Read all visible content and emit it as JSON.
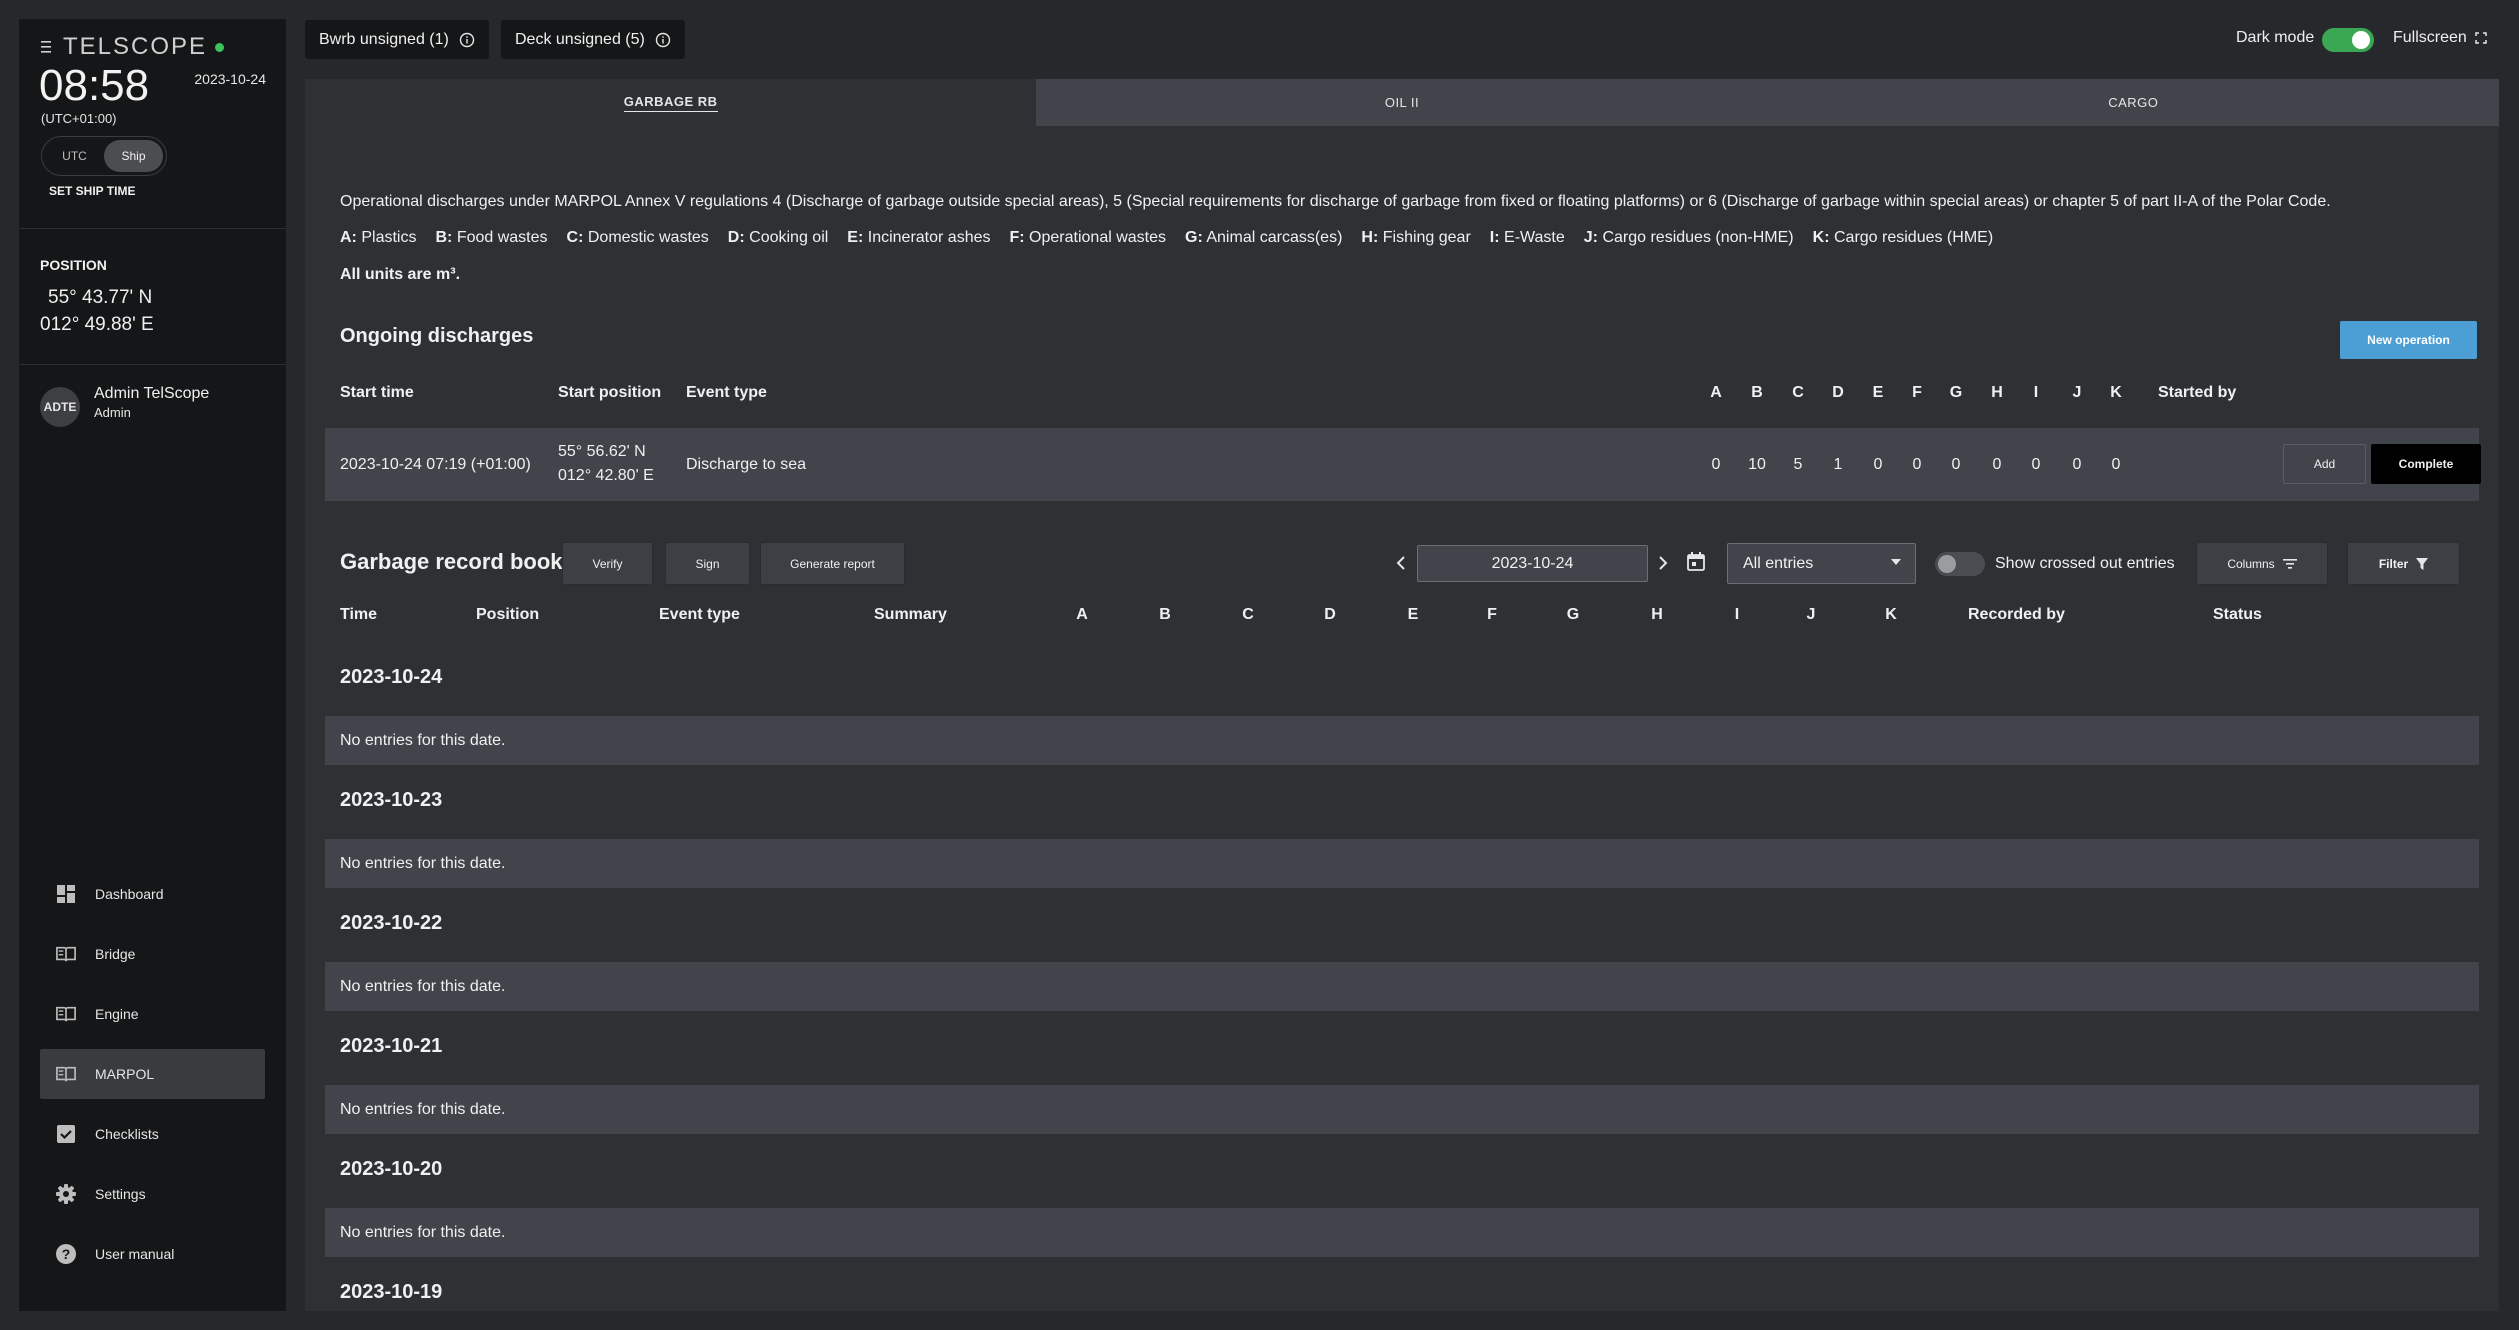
{
  "brand": {
    "name": "TELSCOPE"
  },
  "clock": {
    "time": "08:58",
    "date": "2023-10-24",
    "offset": "(UTC+01:00)",
    "toggle": [
      "UTC",
      "Ship"
    ],
    "selected": "Ship",
    "set_ship_time": "SET SHIP TIME"
  },
  "position": {
    "title": "POSITION",
    "lat": "55° 43.77' N",
    "lon": "012° 49.88' E"
  },
  "user": {
    "initials": "ADTE",
    "name": "Admin TelScope",
    "role": "Admin"
  },
  "nav": [
    {
      "label": "Dashboard",
      "icon": "dashboard-icon"
    },
    {
      "label": "Bridge",
      "icon": "book-icon"
    },
    {
      "label": "Engine",
      "icon": "book-icon"
    },
    {
      "label": "MARPOL",
      "icon": "book-icon",
      "active": true
    },
    {
      "label": "Checklists",
      "icon": "checkbox-icon"
    },
    {
      "label": "Settings",
      "icon": "gear-icon"
    },
    {
      "label": "User manual",
      "icon": "help-icon"
    }
  ],
  "topbar": {
    "bwrb": "Bwrb unsigned (1)",
    "deck": "Deck unsigned (5)",
    "dark_mode": "Dark mode",
    "dark_mode_on": true,
    "fullscreen": "Fullscreen"
  },
  "tabs": [
    "GARBAGE RB",
    "OIL II",
    "CARGO"
  ],
  "active_tab": "GARBAGE RB",
  "description": "Operational discharges under MARPOL Annex V regulations 4 (Discharge of garbage outside special areas), 5 (Special requirements for discharge of garbage from fixed or floating platforms) or 6 (Discharge of garbage within special areas) or chapter 5 of part II-A of the Polar Code.",
  "categories": [
    {
      "code": "A:",
      "name": "Plastics"
    },
    {
      "code": "B:",
      "name": "Food wastes"
    },
    {
      "code": "C:",
      "name": "Domestic wastes"
    },
    {
      "code": "D:",
      "name": "Cooking oil"
    },
    {
      "code": "E:",
      "name": "Incinerator ashes"
    },
    {
      "code": "F:",
      "name": "Operational wastes"
    },
    {
      "code": "G:",
      "name": "Animal carcass(es)"
    },
    {
      "code": "H:",
      "name": "Fishing gear"
    },
    {
      "code": "I:",
      "name": "E-Waste"
    },
    {
      "code": "J:",
      "name": "Cargo residues (non-HME)"
    },
    {
      "code": "K:",
      "name": "Cargo residues (HME)"
    }
  ],
  "units_note": "All units are m³.",
  "ongoing": {
    "title": "Ongoing discharges",
    "new_operation": "New operation",
    "headers": {
      "start_time": "Start time",
      "start_position": "Start position",
      "event_type": "Event type",
      "started_by": "Started by"
    },
    "letters": [
      "A",
      "B",
      "C",
      "D",
      "E",
      "F",
      "G",
      "H",
      "I",
      "J",
      "K"
    ],
    "row": {
      "start_time": "2023-10-24 07:19 (+01:00)",
      "lat": "55° 56.62' N",
      "lon": "012° 42.80' E",
      "event_type": "Discharge to sea",
      "values": [
        "0",
        "10",
        "5",
        "1",
        "0",
        "0",
        "0",
        "0",
        "0",
        "0",
        "0"
      ],
      "add": "Add",
      "complete": "Complete"
    }
  },
  "record_book": {
    "title": "Garbage record book",
    "verify": "Verify",
    "sign": "Sign",
    "generate_report": "Generate report",
    "date": "2023-10-24",
    "entries_filter": "All entries",
    "show_crossed": "Show crossed out entries",
    "columns": "Columns",
    "filter": "Filter",
    "headers": {
      "time": "Time",
      "position": "Position",
      "event_type": "Event type",
      "summary": "Summary",
      "recorded_by": "Recorded by",
      "status": "Status"
    },
    "sections": [
      {
        "date": "2023-10-24",
        "message": "No entries for this date."
      },
      {
        "date": "2023-10-23",
        "message": "No entries for this date."
      },
      {
        "date": "2023-10-22",
        "message": "No entries for this date."
      },
      {
        "date": "2023-10-21",
        "message": "No entries for this date."
      },
      {
        "date": "2023-10-20",
        "message": "No entries for this date."
      },
      {
        "date": "2023-10-19",
        "message": ""
      }
    ]
  }
}
